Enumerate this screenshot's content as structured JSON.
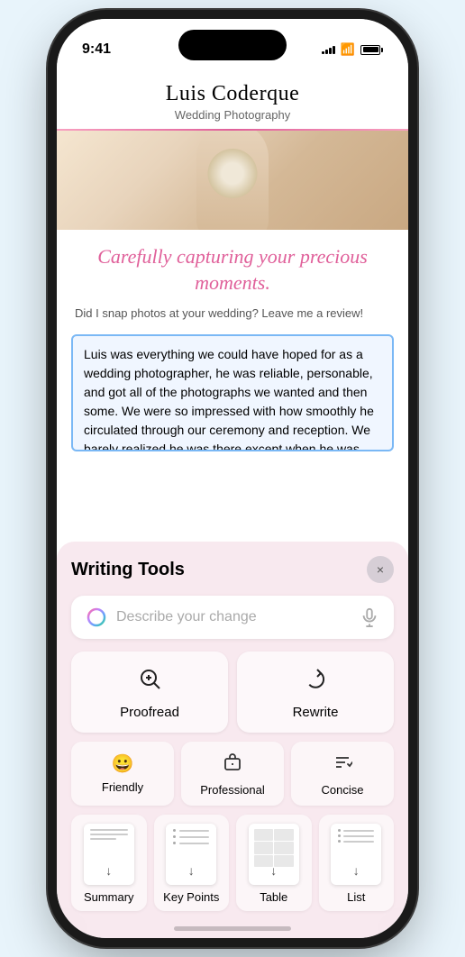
{
  "phone": {
    "status_bar": {
      "time": "9:41",
      "signal_bars": [
        3,
        5,
        7,
        9,
        11
      ],
      "wifi": "wifi",
      "battery_full": true
    }
  },
  "website": {
    "title": "Luis Coderque",
    "subtitle": "Wedding Photography",
    "tagline": "Carefully capturing your precious moments.",
    "review_prompt": "Did I snap photos at your wedding? Leave me a review!",
    "review_text": "Luis was everything we could have hoped for as a wedding photographer, he was reliable, personable, and got all of the photographs we wanted and then some. We were so impressed with how smoothly he circulated through our ceremony and reception. We barely realized he was there except when he was very"
  },
  "writing_tools": {
    "title": "Writing Tools",
    "close_label": "×",
    "describe_placeholder": "Describe your change",
    "buttons": {
      "proofread": "Proofread",
      "rewrite": "Rewrite",
      "friendly": "Friendly",
      "professional": "Professional",
      "concise": "Concise",
      "summary": "Summary",
      "key_points": "Key Points",
      "table": "Table",
      "list": "List"
    }
  }
}
